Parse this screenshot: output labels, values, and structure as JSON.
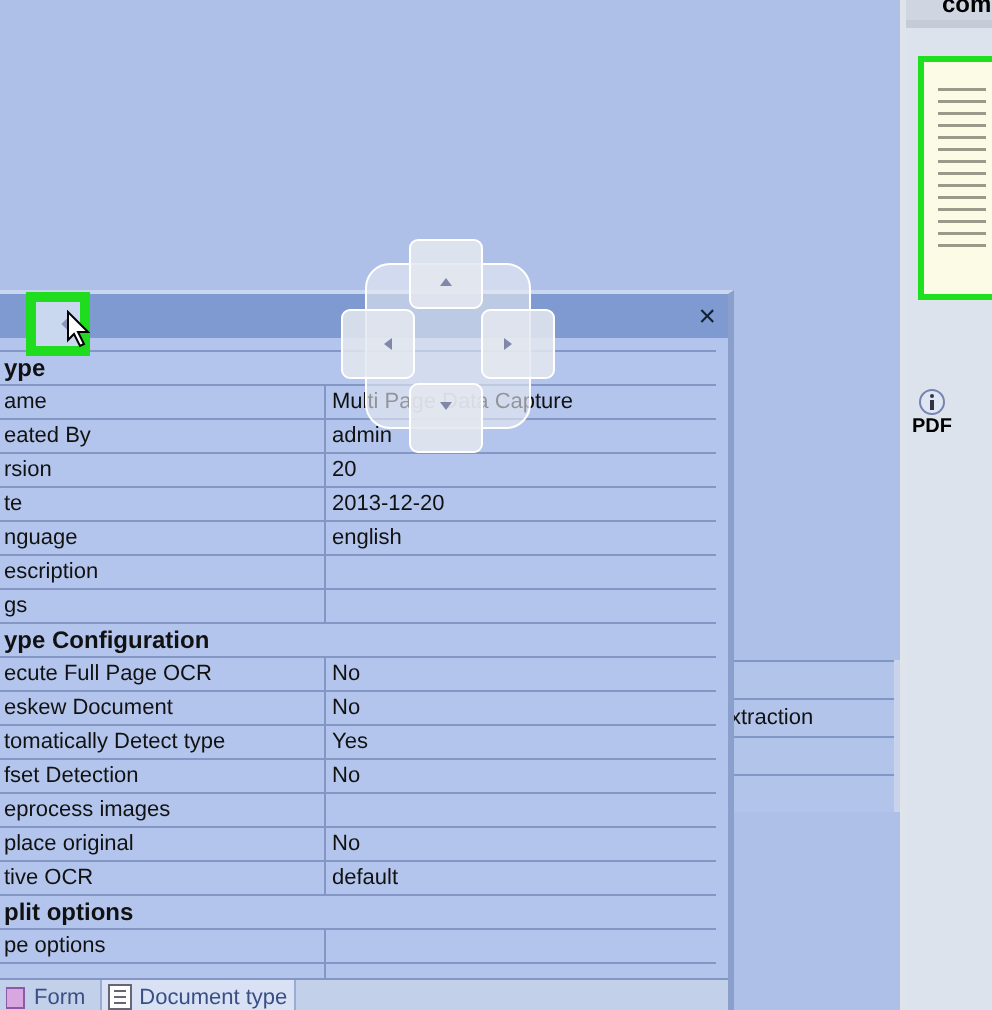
{
  "background_table": {
    "rows": [
      "",
      "xtraction",
      "",
      ""
    ]
  },
  "side_panel": {
    "title": "com",
    "file_label": "PDF"
  },
  "properties_window": {
    "close": "×",
    "rows": [
      {
        "kind": "group",
        "label": "ype"
      },
      {
        "kind": "prop",
        "label": "ame",
        "value": "Multi Page Data Capture"
      },
      {
        "kind": "prop",
        "label": "eated By",
        "value": "admin"
      },
      {
        "kind": "prop",
        "label": "rsion",
        "value": "20"
      },
      {
        "kind": "prop",
        "label": "te",
        "value": "2013-12-20"
      },
      {
        "kind": "prop",
        "label": "nguage",
        "value": "english"
      },
      {
        "kind": "prop",
        "label": "escription",
        "value": ""
      },
      {
        "kind": "prop",
        "label": "gs",
        "value": ""
      },
      {
        "kind": "group",
        "label": "ype Configuration"
      },
      {
        "kind": "prop",
        "label": "ecute Full Page OCR",
        "value": "No"
      },
      {
        "kind": "prop",
        "label": "eskew Document",
        "value": "No"
      },
      {
        "kind": "prop",
        "label": "tomatically Detect type",
        "value": "Yes"
      },
      {
        "kind": "prop",
        "label": "fset Detection",
        "value": "No"
      },
      {
        "kind": "prop",
        "label": "eprocess images",
        "value": ""
      },
      {
        "kind": "prop",
        "label": "place original",
        "value": "No"
      },
      {
        "kind": "prop",
        "label": "tive OCR",
        "value": "default"
      },
      {
        "kind": "group",
        "label": "plit options"
      },
      {
        "kind": "prop",
        "label": "pe options",
        "value": ""
      },
      {
        "kind": "prop",
        "label": "",
        "value": ""
      }
    ],
    "tabs": [
      {
        "label": "Form",
        "selected": false
      },
      {
        "label": "Document type",
        "selected": true
      }
    ]
  }
}
